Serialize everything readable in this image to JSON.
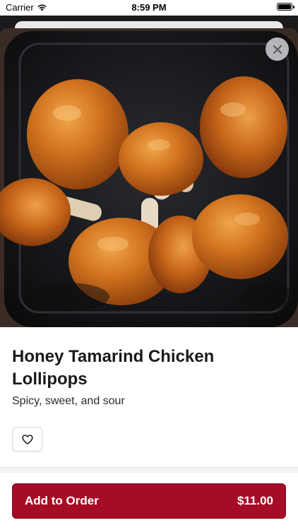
{
  "status_bar": {
    "carrier": "Carrier",
    "time": "8:59 PM",
    "wifi_icon": "wifi-icon",
    "battery_icon": "battery-icon"
  },
  "item": {
    "name": "Honey Tamarind Chicken Lollipops",
    "description": "Spicy, sweet, and sour",
    "image_icon": "food-photo"
  },
  "actions": {
    "close_icon": "close-icon",
    "favorite_icon": "heart-icon",
    "add_label": "Add to Order",
    "price": "$11.00"
  },
  "colors": {
    "accent": "#a50d26",
    "background": "#ffffff",
    "text": "#1a1a1a"
  }
}
